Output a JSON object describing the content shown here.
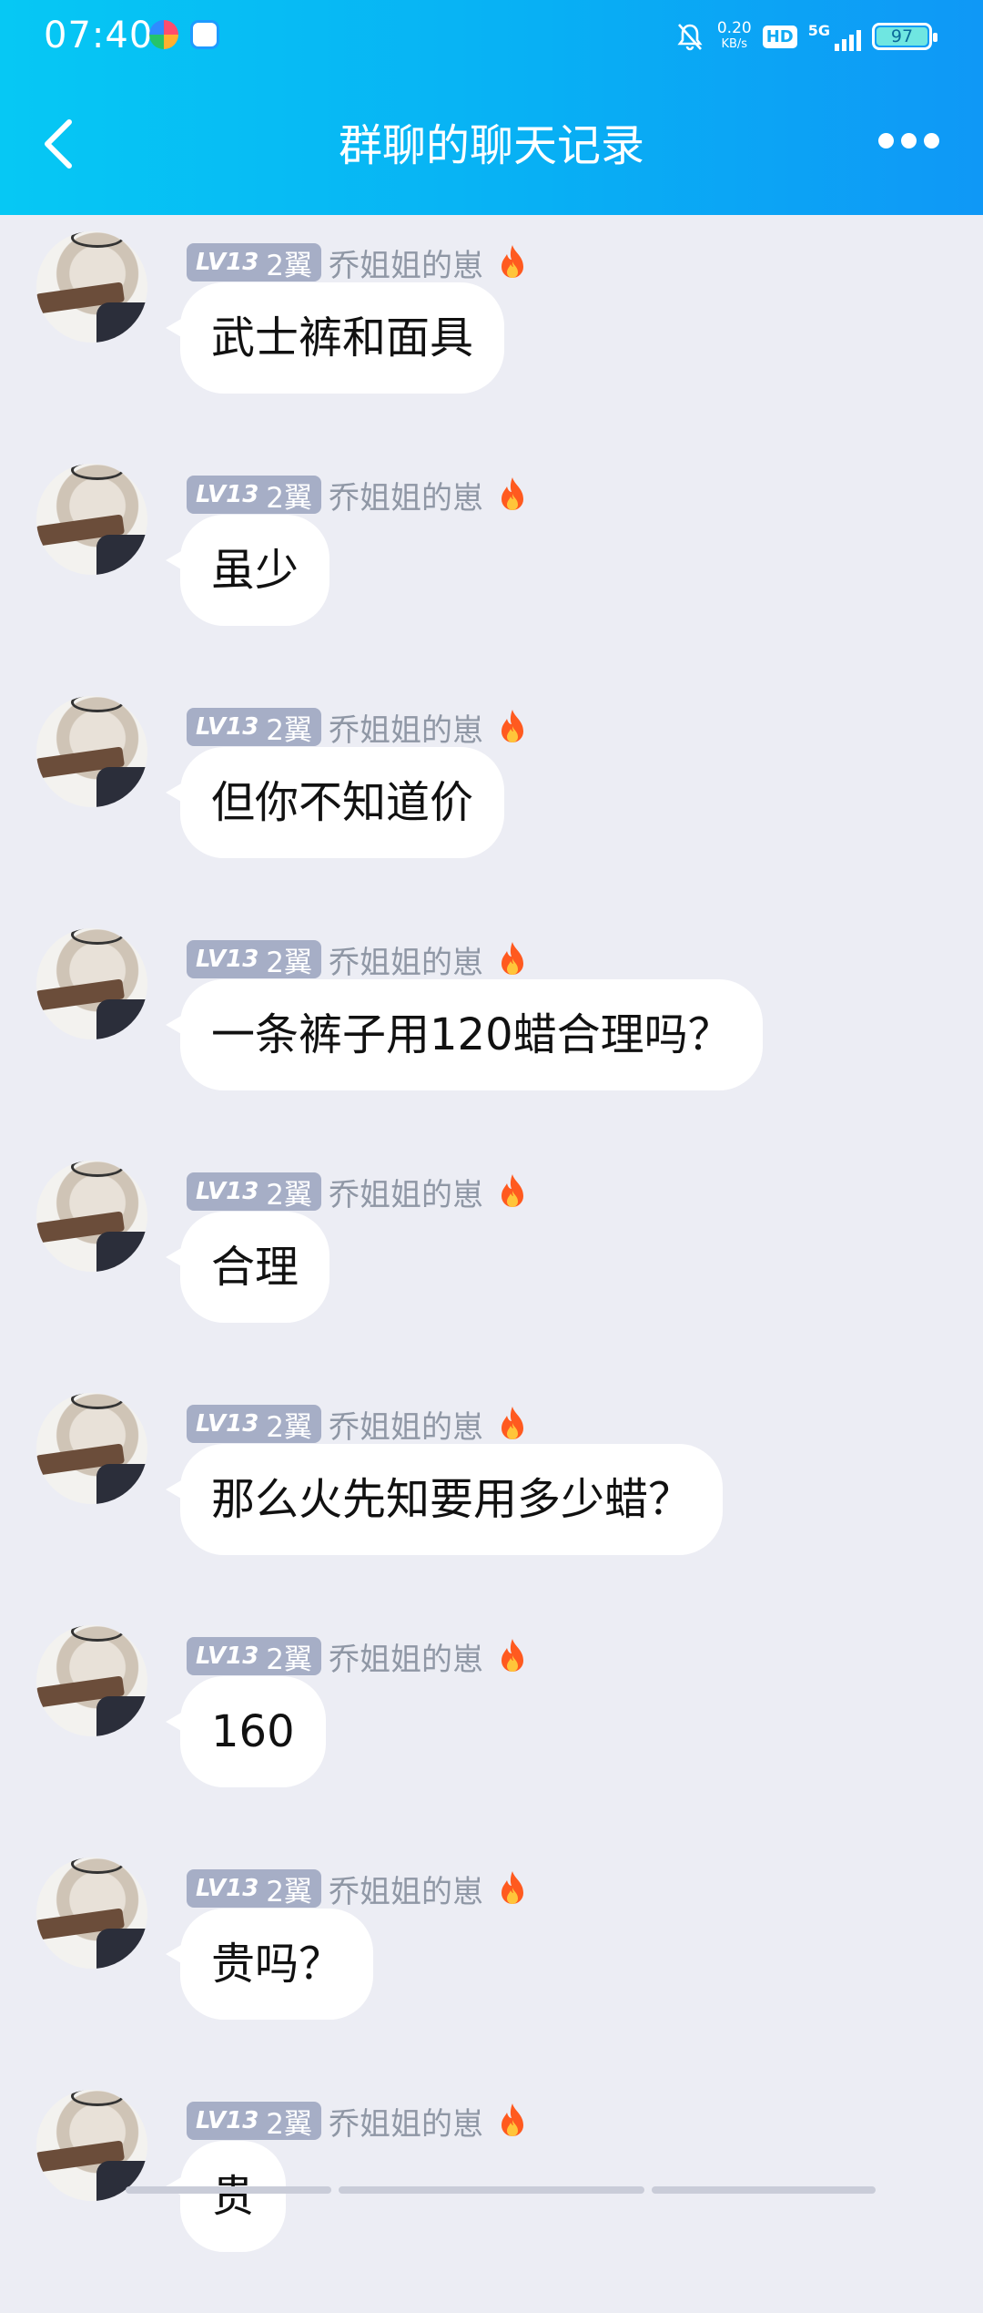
{
  "status_bar": {
    "time": "07:40",
    "net_speed": "0.20",
    "net_unit": "KB/s",
    "hd": "HD",
    "signal": "5G",
    "battery": "97"
  },
  "header": {
    "title": "群聊的聊天记录"
  },
  "sender": {
    "level": "LV13",
    "wing": "2翼",
    "nickname": "乔姐姐的崽"
  },
  "messages": [
    {
      "text": "武士裤和面具"
    },
    {
      "text": "虽少"
    },
    {
      "text": "但你不知道价"
    },
    {
      "text": "一条裤子用120蜡合理吗？"
    },
    {
      "text": "合理"
    },
    {
      "text": "那么火先知要用多少蜡？"
    },
    {
      "text": "160"
    },
    {
      "text": "贵吗？"
    },
    {
      "text": "贵"
    }
  ],
  "colors": {
    "header_start": "#06c8f4",
    "header_end": "#0f98f6",
    "background": "#ecedf4",
    "badge": "#a6aec6"
  }
}
